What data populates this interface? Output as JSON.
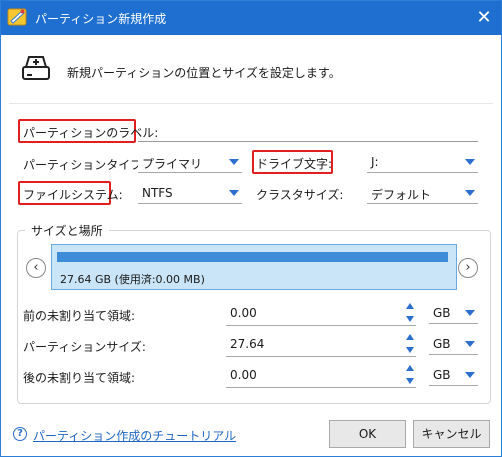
{
  "window": {
    "title": "パーティション新規作成",
    "close_label": "✕"
  },
  "header": {
    "description": "新規パーティションの位置とサイズを設定します。"
  },
  "form": {
    "label_label": "パーティションのラベル:",
    "label_value": "",
    "type_label": "パーティションタイプ:",
    "type_value": "プライマリ",
    "drive_label": "ドライブ文字:",
    "drive_value": "J:",
    "fs_label": "ファイルシステム:",
    "fs_value": "NTFS",
    "cluster_label": "クラスタサイズ:",
    "cluster_value": "デフォルト"
  },
  "size_group": {
    "title": "サイズと場所",
    "partition_text": "27.64 GB (使用済:0.00 MB)",
    "fields": [
      {
        "label": "前の未割り当て領域:",
        "value": "0.00",
        "unit": "GB"
      },
      {
        "label": "パーティションサイズ:",
        "value": "27.64",
        "unit": "GB"
      },
      {
        "label": "後の未割り当て領域:",
        "value": "0.00",
        "unit": "GB"
      }
    ]
  },
  "footer": {
    "help_link": "パーティション作成のチュートリアル",
    "ok_label": "OK",
    "cancel_label": "キャンセル"
  },
  "colors": {
    "titlebar": "#1e6fd0",
    "highlight": "#e02020",
    "partition_fill": "#c9e5f7",
    "accent": "#2c6fce"
  }
}
